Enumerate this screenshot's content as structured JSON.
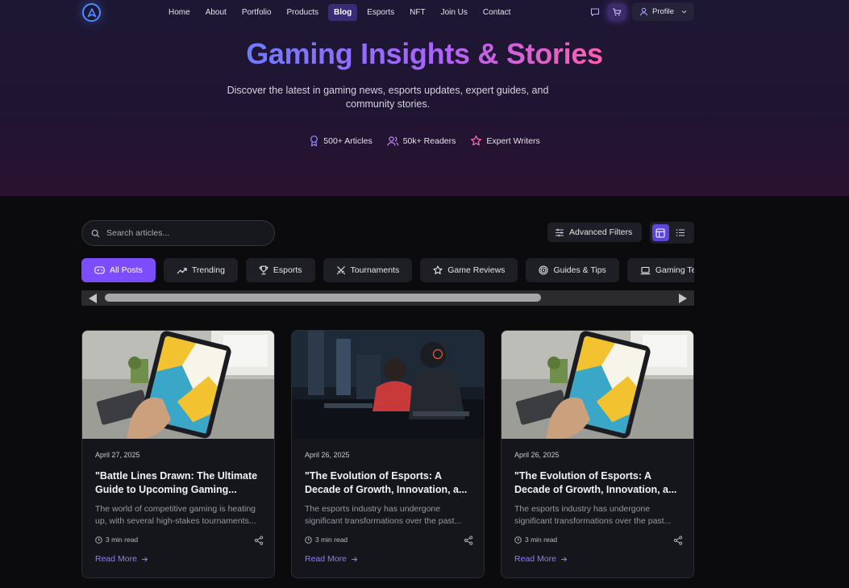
{
  "nav": {
    "links": [
      "Home",
      "About",
      "Portfolio",
      "Products",
      "Blog",
      "Esports",
      "NFT",
      "Join Us",
      "Contact"
    ],
    "active": "Blog",
    "profile_label": "Profile"
  },
  "hero": {
    "title": "Gaming Insights & Stories",
    "subtitle": "Discover the latest in gaming news, esports updates, expert guides, and community stories.",
    "stats": [
      "500+ Articles",
      "50k+ Readers",
      "Expert Writers"
    ]
  },
  "toolbar": {
    "search_placeholder": "Search articles...",
    "advanced_filters_label": "Advanced Filters",
    "view_mode": "grid"
  },
  "categories": [
    {
      "label": "All Posts",
      "icon": "gamepad-icon",
      "active": true
    },
    {
      "label": "Trending",
      "icon": "trending-icon",
      "active": false
    },
    {
      "label": "Esports",
      "icon": "trophy-icon",
      "active": false
    },
    {
      "label": "Tournaments",
      "icon": "swords-icon",
      "active": false
    },
    {
      "label": "Game Reviews",
      "icon": "star-icon",
      "active": false
    },
    {
      "label": "Guides & Tips",
      "icon": "target-icon",
      "active": false
    },
    {
      "label": "Gaming Tech",
      "icon": "laptop-icon",
      "active": false
    }
  ],
  "posts": [
    {
      "date": "April 27, 2025",
      "title": "\"Battle Lines Drawn: The Ultimate Guide to Upcoming Gaming...",
      "excerpt": "The world of competitive gaming is heating up, with several high-stakes tournaments...",
      "read_time": "3 min read",
      "read_more": "Read More",
      "image": "tablet"
    },
    {
      "date": "April 26, 2025",
      "title": "\"The Evolution of Esports: A Decade of Growth, Innovation, a...",
      "excerpt": "The esports industry has undergone significant transformations over the past...",
      "read_time": "3 min read",
      "read_more": "Read More",
      "image": "esports"
    },
    {
      "date": "April 26, 2025",
      "title": "\"The Evolution of Esports: A Decade of Growth, Innovation, a...",
      "excerpt": "The esports industry has undergone significant transformations over the past...",
      "read_time": "3 min read",
      "read_more": "Read More",
      "image": "tablet"
    }
  ],
  "colors": {
    "accent": "#7c4dff",
    "nav_active": "#3a2a78",
    "link": "#8c7cff"
  }
}
